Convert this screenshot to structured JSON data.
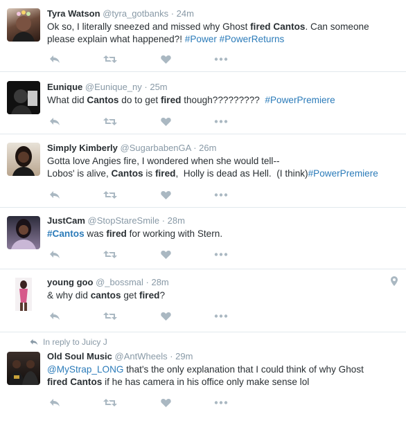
{
  "tweets": [
    {
      "name": "Tyra Watson",
      "handle": "@tyra_gotbanks",
      "time": "· 24m",
      "line1": [
        "Ok so, I literally sneezed and missed why Ghost ",
        "fired Cantos",
        ". Can someone"
      ],
      "line2": [
        "please explain what happened?! ",
        "#Power #PowerReturns"
      ]
    },
    {
      "name": "Eunique",
      "handle": "@Eunique_ny",
      "time": "· 25m",
      "line1": [
        "What did ",
        "Cantos",
        " do to get ",
        "fired",
        " though?????????  ",
        "#PowerPremiere"
      ]
    },
    {
      "name": "Simply Kimberly",
      "handle": "@SugarbabenGA",
      "time": "· 26m",
      "line1": [
        "Gotta love Angies fire, I wondered when she would tell--"
      ],
      "line2": [
        "Lobos' is alive, ",
        "Cantos",
        " is ",
        "fired",
        ",  Holly is dead as Hell.  (I think)",
        "#PowerPremiere"
      ]
    },
    {
      "name": "JustCam",
      "handle": "@StopStareSmile",
      "time": "· 28m",
      "line1": [
        "#Cantos",
        " was ",
        "fired",
        " for working with Stern."
      ]
    },
    {
      "name": "young goo",
      "handle": "@_bossmal",
      "time": "· 28m",
      "line1": [
        "& why did ",
        "cantos",
        " get ",
        "fired",
        "?"
      ]
    },
    {
      "reply_to": "In reply to Juicy J",
      "name": "Old Soul Music",
      "handle": "@AntWheels",
      "time": "· 29m",
      "line1": [
        "@MyStrap_LONG",
        " that's the only explanation that I could think of why Ghost"
      ],
      "line2": [
        "fired Cantos",
        " if he has camera in his office only make sense lol"
      ]
    }
  ],
  "icons": {
    "reply": "reply-icon",
    "retweet": "retweet-icon",
    "like": "heart-icon",
    "more": "more-dots-icon",
    "location": "location-pin-icon"
  },
  "colors": {
    "link": "#2b7bb9",
    "muted": "#8899a6",
    "divider": "#e1e8ed",
    "icon": "#aab8c2"
  }
}
